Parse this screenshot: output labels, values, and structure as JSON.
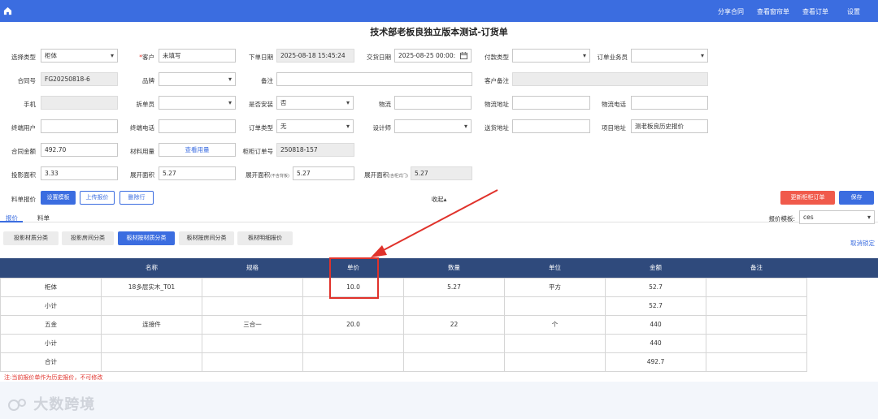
{
  "nav": {
    "links": [
      "分享合同",
      "查看窗帘单",
      "查看订单",
      "设置"
    ]
  },
  "page": {
    "title": "技术部老板良独立版本测试-订货单"
  },
  "form": {
    "select_type": {
      "label": "选择类型",
      "value": "柜体"
    },
    "customer": {
      "required_mark": "*",
      "label": "客户",
      "value": "未填写"
    },
    "order_date": {
      "label": "下单日期",
      "value": "2025-08-18 15:45:24"
    },
    "delivery_date": {
      "label": "交货日期",
      "value": "2025-08-25 00:00:"
    },
    "payment_type": {
      "label": "付款类型",
      "value": ""
    },
    "order_salesman": {
      "label": "订单业务员",
      "value": ""
    },
    "contract_no": {
      "label": "合同号",
      "value": "FG20250818-6"
    },
    "brand": {
      "label": "品牌",
      "value": ""
    },
    "remark": {
      "label": "备注",
      "value": ""
    },
    "customer_remark": {
      "label": "客户备注",
      "value": ""
    },
    "phone": {
      "label": "手机",
      "value": ""
    },
    "split_staff": {
      "label": "拆单员",
      "value": ""
    },
    "need_install": {
      "label": "是否安装",
      "value": "否"
    },
    "logistics": {
      "label": "物流",
      "value": ""
    },
    "logistics_address": {
      "label": "物流地址",
      "value": ""
    },
    "logistics_phone": {
      "label": "物流电话",
      "value": ""
    },
    "end_user": {
      "label": "终端用户",
      "value": ""
    },
    "end_phone": {
      "label": "终端电话",
      "value": ""
    },
    "order_type": {
      "label": "订单类型",
      "value": "无"
    },
    "designer": {
      "label": "设计师",
      "value": ""
    },
    "delivery_address": {
      "label": "送货地址",
      "value": ""
    },
    "project_address": {
      "label": "项目地址",
      "value": "测老板良历史报价"
    },
    "contract_amount": {
      "label": "合同金额",
      "value": "492.70"
    },
    "material_usage": {
      "label": "材料用量",
      "button": "查看用量"
    },
    "cabinet_order_no": {
      "label": "柜柜订单号",
      "value": "250818-157"
    },
    "projection_area": {
      "label": "投影面积",
      "value": "3.33"
    },
    "expand_area": {
      "label": "展开面积",
      "value": "5.27"
    },
    "expand_area_no_back": {
      "label": "展开面积",
      "sub": "(不含背板)",
      "value": "5.27"
    },
    "expand_area_with_door": {
      "label": "展开面积",
      "sub": "(含柜式门)",
      "value": "5.27"
    }
  },
  "toolbar": {
    "quote_label": "料单报价",
    "set_template": "设置模板",
    "upload_quote": "上传报价",
    "delete_row": "删除行",
    "collapse": "收起▴",
    "update_order": "更新柜柜订单",
    "save": "保存"
  },
  "tabs": [
    "报价",
    "料单"
  ],
  "template": {
    "label": "报价模板:",
    "value": "ces"
  },
  "categories": [
    "投影材质分类",
    "投影房间分类",
    "板材按材质分类",
    "板材按房间分类",
    "板材明细报价"
  ],
  "unlock": "取消锁定",
  "table": {
    "headers": [
      "",
      "名称",
      "规格",
      "单价",
      "数量",
      "单位",
      "金额",
      "备注"
    ],
    "rows": [
      [
        "柜体",
        "18多层实木_T01",
        "",
        "10.0",
        "5.27",
        "平方",
        "52.7",
        ""
      ],
      [
        "小计",
        "",
        "",
        "",
        "",
        "",
        "52.7",
        ""
      ],
      [
        "五金",
        "连接件",
        "三合一",
        "20.0",
        "22",
        "个",
        "440",
        ""
      ],
      [
        "小计",
        "",
        "",
        "",
        "",
        "",
        "440",
        ""
      ],
      [
        "合计",
        "",
        "",
        "",
        "",
        "",
        "492.7",
        ""
      ]
    ]
  },
  "note": "注:当前报价单作为历史报价，不可修改",
  "watermark": "大数跨境",
  "colors": {
    "primary": "#3b6de0",
    "header": "#2f4a7c",
    "danger": "#f05a4b",
    "highlight": "#e0322b"
  }
}
